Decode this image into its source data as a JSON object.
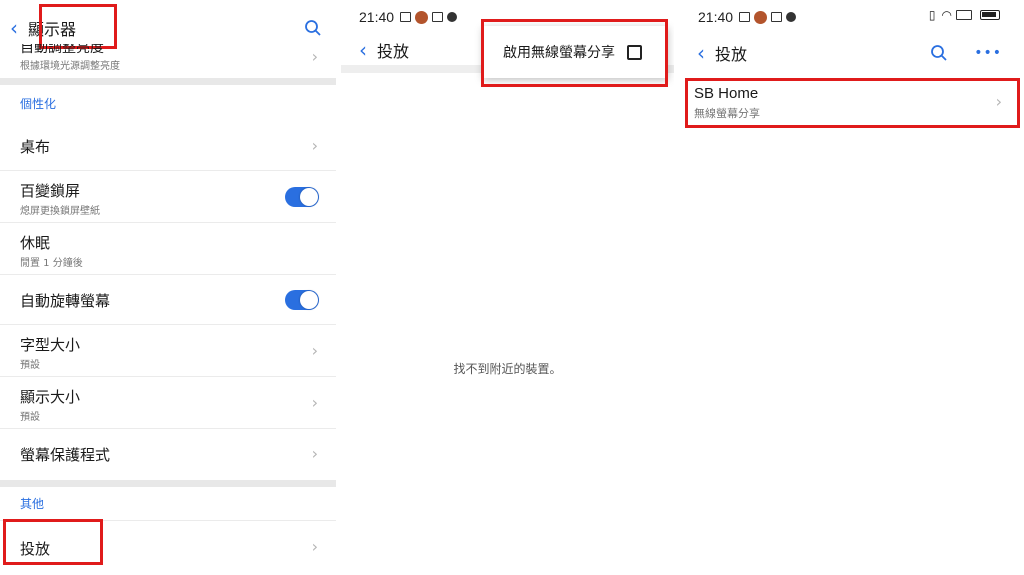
{
  "panel1": {
    "header": {
      "title": "顯示器"
    },
    "partial_row": {
      "title": "自動調整亮度",
      "subtitle": "根據環境光源調整亮度"
    },
    "section_personal": "個性化",
    "rows": [
      {
        "title": "桌布",
        "subtitle": ""
      },
      {
        "title": "百變鎖屏",
        "subtitle": "熄屏更換鎖屏壁紙"
      },
      {
        "title": "休眠",
        "subtitle": "閒置 1 分鐘後"
      },
      {
        "title": "自動旋轉螢幕",
        "subtitle": ""
      },
      {
        "title": "字型大小",
        "subtitle": "預設"
      },
      {
        "title": "顯示大小",
        "subtitle": "預設"
      },
      {
        "title": "螢幕保護程式",
        "subtitle": ""
      }
    ],
    "section_other": "其他",
    "cast_row": {
      "title": "投放"
    }
  },
  "panel2": {
    "status": {
      "time": "21:40"
    },
    "header": {
      "title": "投放"
    },
    "menu": {
      "enable_wireless_display": "啟用無線螢幕分享"
    },
    "empty_message": "找不到附近的裝置。"
  },
  "panel3": {
    "status": {
      "time": "21:40"
    },
    "header": {
      "title": "投放"
    },
    "device": {
      "name": "SB Home",
      "subtitle": "無線螢幕分享"
    }
  },
  "colors": {
    "accent": "#2a6fe0",
    "highlight": "#e01b1b"
  }
}
